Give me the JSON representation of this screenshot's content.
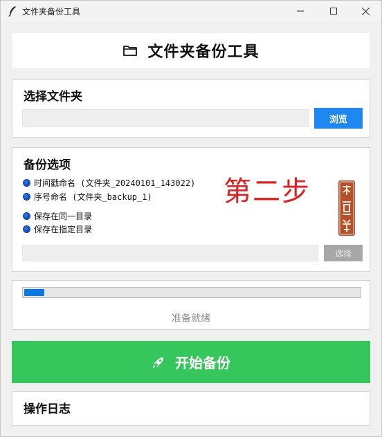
{
  "window": {
    "title": "文件夹备份工具"
  },
  "header": {
    "title": "文件夹备份工具",
    "icon": "folder-icon"
  },
  "folder_section": {
    "title": "选择文件夹",
    "path_value": "",
    "browse_label": "浏览",
    "browse_color": "#1f87f0"
  },
  "options_section": {
    "title": "备份选项",
    "naming_options": [
      {
        "label": "时间戳命名 (文件夹_20240101_143022)"
      },
      {
        "label": "序号命名 (文件夹_backup_1)"
      }
    ],
    "location_options": [
      {
        "label": "保存在同一目录"
      },
      {
        "label": "保存在指定目录"
      }
    ],
    "annotation": "第二步",
    "annotation_color": "#e02020",
    "seal_text": "乐意学",
    "target_value": "",
    "select_label": "选择"
  },
  "progress": {
    "value_percent": 6,
    "status": "准备就绪"
  },
  "start_button": {
    "label": "开始备份",
    "icon": "rocket-icon",
    "color": "#35c65c"
  },
  "log_section": {
    "title": "操作日志"
  }
}
